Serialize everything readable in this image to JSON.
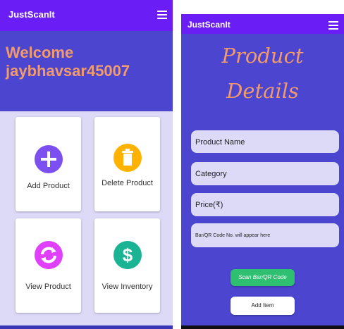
{
  "left_screen": {
    "app_title": "JustScanIt",
    "welcome_line1": "Welcome",
    "welcome_line2": "jaybhavsar45007",
    "cards": [
      {
        "label": "Add Product",
        "icon": "plus-icon",
        "color": "#7b4ff0"
      },
      {
        "label": "Delete Product",
        "icon": "trash-icon",
        "color": "#ffb300"
      },
      {
        "label": "View Product",
        "icon": "refresh-icon",
        "color": "#e040fb"
      },
      {
        "label": "View Inventory",
        "icon": "dollar-icon",
        "color": "#1ab394"
      }
    ]
  },
  "right_screen": {
    "app_title": "JustScanIt",
    "heading_line1": "Product",
    "heading_line2": "Details",
    "fields": {
      "product_name": "Product Name",
      "category": "Category",
      "price": "Price(₹)",
      "barcode": "Bar/QR Code No. will appear here"
    },
    "scan_button": "Scan Bar/QR Code",
    "add_button": "Add Item"
  },
  "colors": {
    "appbar": "#6a1df5",
    "primary_bg": "#4b45cf",
    "accent_text": "#f19a6c",
    "field_bg": "#dcdaf7",
    "scan_button": "#2fbf71"
  }
}
